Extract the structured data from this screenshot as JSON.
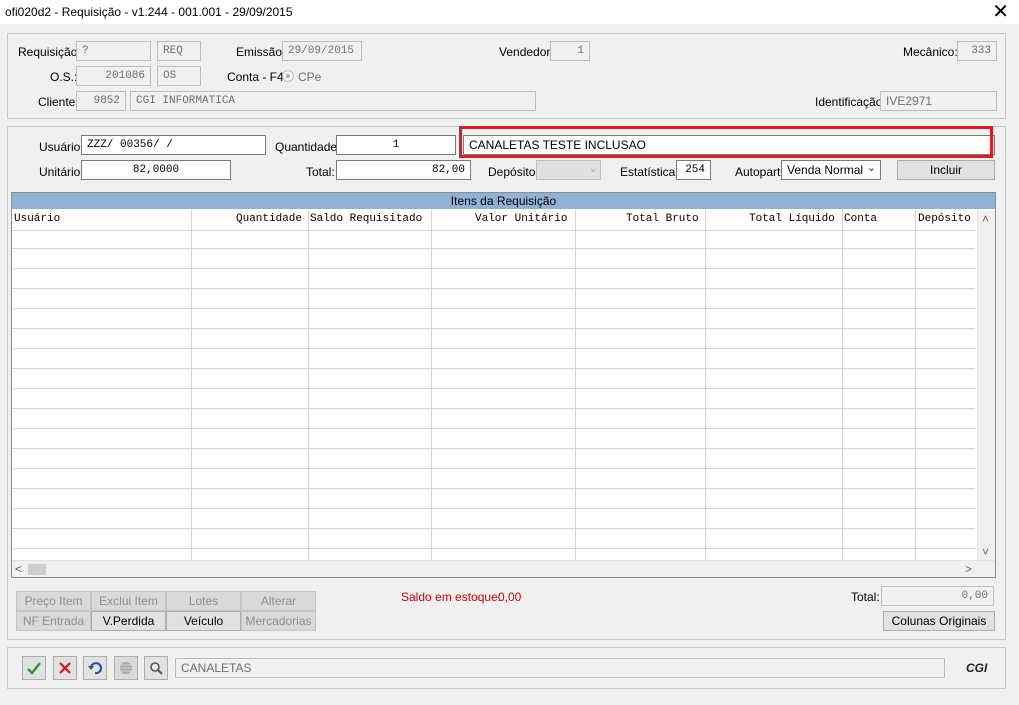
{
  "window": {
    "title": "ofi020d2 - Requisição - v1.244 - 001.001 - 29/09/2015",
    "close_glyph": "✕"
  },
  "header": {
    "requisicao_label": "Requisição:",
    "requisicao_value": "?",
    "requisicao_type": "REQ",
    "emissao_label": "Emissão:",
    "emissao_value": "29/09/2015",
    "vendedor_label": "Vendedor:",
    "vendedor_value": "1",
    "mecanico_label": "Mecânico:",
    "mecanico_value": "333",
    "os_label": "O.S.:",
    "os_value": "201086",
    "os_type": "OS",
    "conta_label": "Conta - F4:",
    "conta_option": "CPe",
    "cliente_label": "Cliente:",
    "cliente_code": "9852",
    "cliente_name": "CGI INFORMATICA",
    "identificacao_label": "Identificação:",
    "identificacao_value": "IVE2971"
  },
  "item_form": {
    "usuario_label": "Usuário:",
    "usuario_value": "ZZZ/  00356/  /",
    "quantidade_label": "Quantidade:",
    "quantidade_value": "1",
    "descricao_value": "CANALETAS TESTE INCLUSAO",
    "unitario_label": "Unitário:",
    "unitario_value": "82,0000",
    "total_label": "Total:",
    "total_value": "82,00",
    "deposito_label": "Depósito:",
    "deposito_value": "",
    "estatistica_label": "Estatística:",
    "estatistica_value": "254",
    "autopart_label": "Autopart:",
    "autopart_value": "Venda Normal",
    "incluir_label": "Incluir"
  },
  "grid": {
    "caption": "Itens da Requisição",
    "columns": [
      "Usuário",
      "Quantidade",
      "Saldo Requisitado",
      "Valor Unitário",
      "Total Bruto",
      "Total Líquido",
      "Conta",
      "Depósito"
    ],
    "rows": []
  },
  "actions": {
    "preco_item": "Preço Item",
    "exclui_item": "Exclui Item",
    "lotes": "Lotes",
    "alterar": "Alterar",
    "nf_entrada": "NF Entrada",
    "v_perdida": "V.Perdida",
    "veiculo": "Veículo",
    "mercadorias": "Mercadorias",
    "saldo_label": "Saldo em estoque:",
    "saldo_value": "0,00",
    "total_label": "Total:",
    "total_value": "0,00",
    "colunas_originais": "Colunas Originais"
  },
  "footer": {
    "status_text": "CANALETAS",
    "logo_text": "CGI"
  },
  "colors": {
    "highlight": "#e11b22",
    "grid_caption": "#8eb1d4",
    "saldo_text": "#cc0000"
  }
}
